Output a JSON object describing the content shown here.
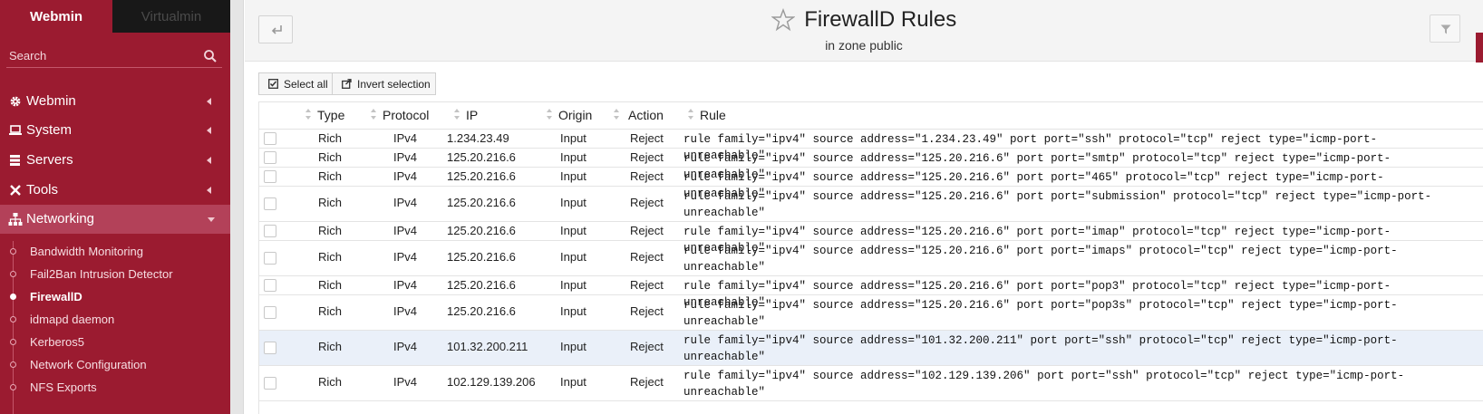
{
  "sidebar": {
    "brand_tabs": {
      "webmin": "Webmin",
      "virtualmin": "Virtualmin"
    },
    "search_placeholder": "Search",
    "menu": [
      {
        "label": "Webmin",
        "icon": "gear-icon"
      },
      {
        "label": "System",
        "icon": "laptop-icon"
      },
      {
        "label": "Servers",
        "icon": "servers-icon"
      },
      {
        "label": "Tools",
        "icon": "tools-icon"
      },
      {
        "label": "Networking",
        "icon": "sitemap-icon",
        "active": true
      }
    ],
    "networking_items": [
      {
        "label": "Bandwidth Monitoring"
      },
      {
        "label": "Fail2Ban Intrusion Detector"
      },
      {
        "label": "FirewallD",
        "current": true
      },
      {
        "label": "idmapd daemon"
      },
      {
        "label": "Kerberos5"
      },
      {
        "label": "Network Configuration"
      },
      {
        "label": "NFS Exports"
      }
    ]
  },
  "header": {
    "title": "FirewallD Rules",
    "subtitle": "in zone public"
  },
  "toolbar": {
    "select_all": "Select all",
    "invert_selection": "Invert selection"
  },
  "table": {
    "columns": [
      "Type",
      "Protocol",
      "IP",
      "Origin",
      "Action",
      "Rule"
    ],
    "rows": [
      {
        "type": "Rich",
        "protocol": "IPv4",
        "ip": "1.234.23.49",
        "origin": "Input",
        "action": "Reject",
        "rule": "rule family=\"ipv4\" source address=\"1.234.23.49\" port port=\"ssh\" protocol=\"tcp\" reject type=\"icmp-port-unreachable\""
      },
      {
        "type": "Rich",
        "protocol": "IPv4",
        "ip": "125.20.216.6",
        "origin": "Input",
        "action": "Reject",
        "rule": "rule family=\"ipv4\" source address=\"125.20.216.6\" port port=\"smtp\" protocol=\"tcp\" reject type=\"icmp-port-unreachable\""
      },
      {
        "type": "Rich",
        "protocol": "IPv4",
        "ip": "125.20.216.6",
        "origin": "Input",
        "action": "Reject",
        "rule": "rule family=\"ipv4\" source address=\"125.20.216.6\" port port=\"465\" protocol=\"tcp\" reject type=\"icmp-port-unreachable\""
      },
      {
        "type": "Rich",
        "protocol": "IPv4",
        "ip": "125.20.216.6",
        "origin": "Input",
        "action": "Reject",
        "rule": "rule family=\"ipv4\" source address=\"125.20.216.6\" port port=\"submission\" protocol=\"tcp\" reject type=\"icmp-port-unreachable\""
      },
      {
        "type": "Rich",
        "protocol": "IPv4",
        "ip": "125.20.216.6",
        "origin": "Input",
        "action": "Reject",
        "rule": "rule family=\"ipv4\" source address=\"125.20.216.6\" port port=\"imap\" protocol=\"tcp\" reject type=\"icmp-port-unreachable\""
      },
      {
        "type": "Rich",
        "protocol": "IPv4",
        "ip": "125.20.216.6",
        "origin": "Input",
        "action": "Reject",
        "rule": "rule family=\"ipv4\" source address=\"125.20.216.6\" port port=\"imaps\" protocol=\"tcp\" reject type=\"icmp-port-unreachable\""
      },
      {
        "type": "Rich",
        "protocol": "IPv4",
        "ip": "125.20.216.6",
        "origin": "Input",
        "action": "Reject",
        "rule": "rule family=\"ipv4\" source address=\"125.20.216.6\" port port=\"pop3\" protocol=\"tcp\" reject type=\"icmp-port-unreachable\""
      },
      {
        "type": "Rich",
        "protocol": "IPv4",
        "ip": "125.20.216.6",
        "origin": "Input",
        "action": "Reject",
        "rule": "rule family=\"ipv4\" source address=\"125.20.216.6\" port port=\"pop3s\" protocol=\"tcp\" reject type=\"icmp-port-unreachable\""
      },
      {
        "type": "Rich",
        "protocol": "IPv4",
        "ip": "101.32.200.211",
        "origin": "Input",
        "action": "Reject",
        "rule": "rule family=\"ipv4\" source address=\"101.32.200.211\" port port=\"ssh\" protocol=\"tcp\" reject type=\"icmp-port-unreachable\"",
        "highlighted": true
      },
      {
        "type": "Rich",
        "protocol": "IPv4",
        "ip": "102.129.139.206",
        "origin": "Input",
        "action": "Reject",
        "rule": "rule family=\"ipv4\" source address=\"102.129.139.206\" port port=\"ssh\" protocol=\"tcp\" reject type=\"icmp-port-unreachable\""
      }
    ]
  },
  "colors": {
    "sidebar_bg": "#9b1b30",
    "sidebar_active": "#b34159",
    "row_highlight": "#eaf0f9",
    "accent": "#9b1b30"
  }
}
